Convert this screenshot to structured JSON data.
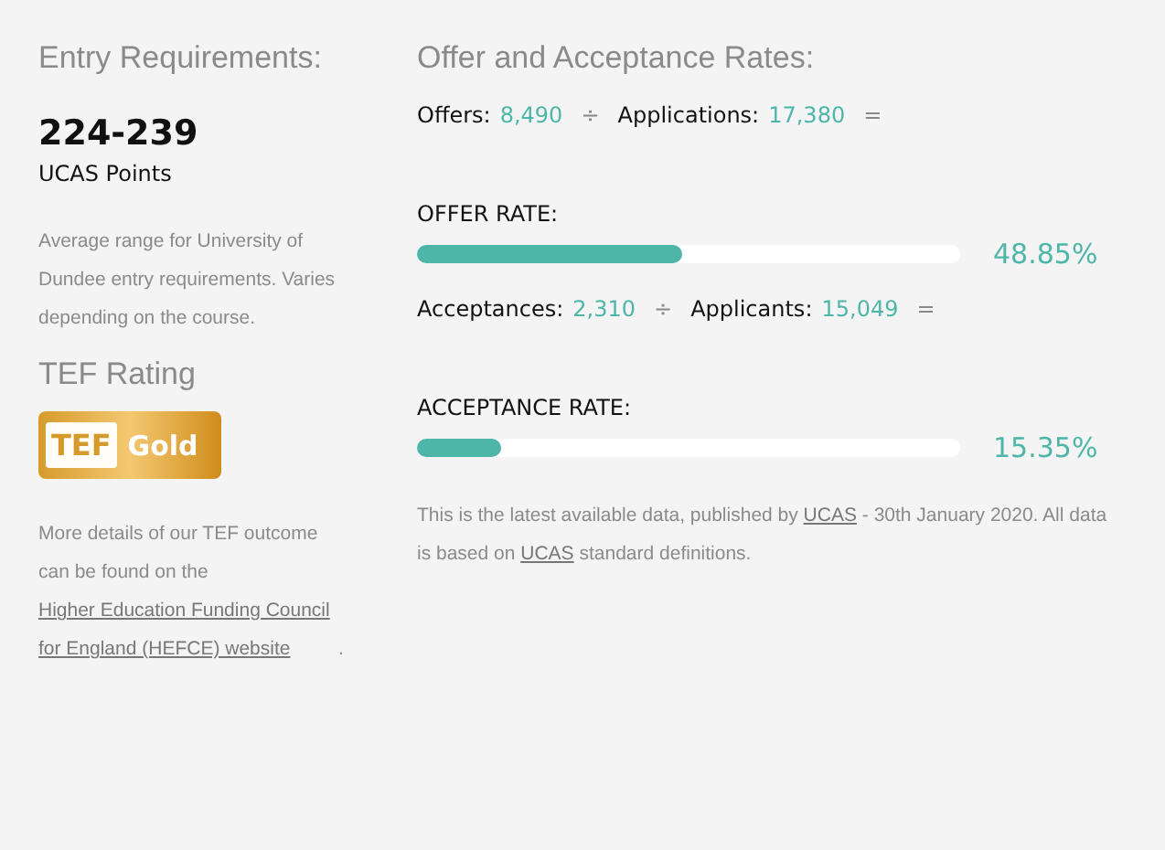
{
  "entry": {
    "heading": "Entry Requirements:",
    "points": "224-239",
    "points_label": "UCAS Points",
    "note": "Average range for University of Dundee entry requirements. Varies depending on the course.",
    "tef_heading": "TEF Rating",
    "tef_badge": {
      "left": "TEF",
      "right": "Gold"
    },
    "tef_note": "More details of our TEF outcome can be found on the",
    "tef_link": "Higher Education Funding Council for England (HEFCE) website",
    "tef_end": "."
  },
  "rates": {
    "heading": "Offer and Acceptance Rates:",
    "rows": [
      {
        "formula": [
          {
            "label": "Offers:",
            "value": "8,490"
          },
          {
            "op": "÷"
          },
          {
            "label": "Applications:",
            "value": "17,380"
          },
          {
            "op": "="
          }
        ],
        "bar_label": "OFFER RATE:",
        "level": 0.4885,
        "reading": "48.85%"
      },
      {
        "formula": [
          {
            "label": "Acceptances:",
            "value": "2,310"
          },
          {
            "op": "÷"
          },
          {
            "label": "Applicants:",
            "value": "15,049"
          },
          {
            "op": "="
          }
        ],
        "bar_label": "ACCEPTANCE RATE:",
        "level": 0.1535,
        "reading": "15.35%"
      }
    ],
    "footnote": [
      {
        "text": "This is the latest available data, published by "
      },
      {
        "link": "UCAS"
      },
      {
        "text": " - 30th January 2020. All data is based on "
      },
      {
        "link": "UCAS"
      },
      {
        "text": " standard definitions."
      }
    ]
  }
}
